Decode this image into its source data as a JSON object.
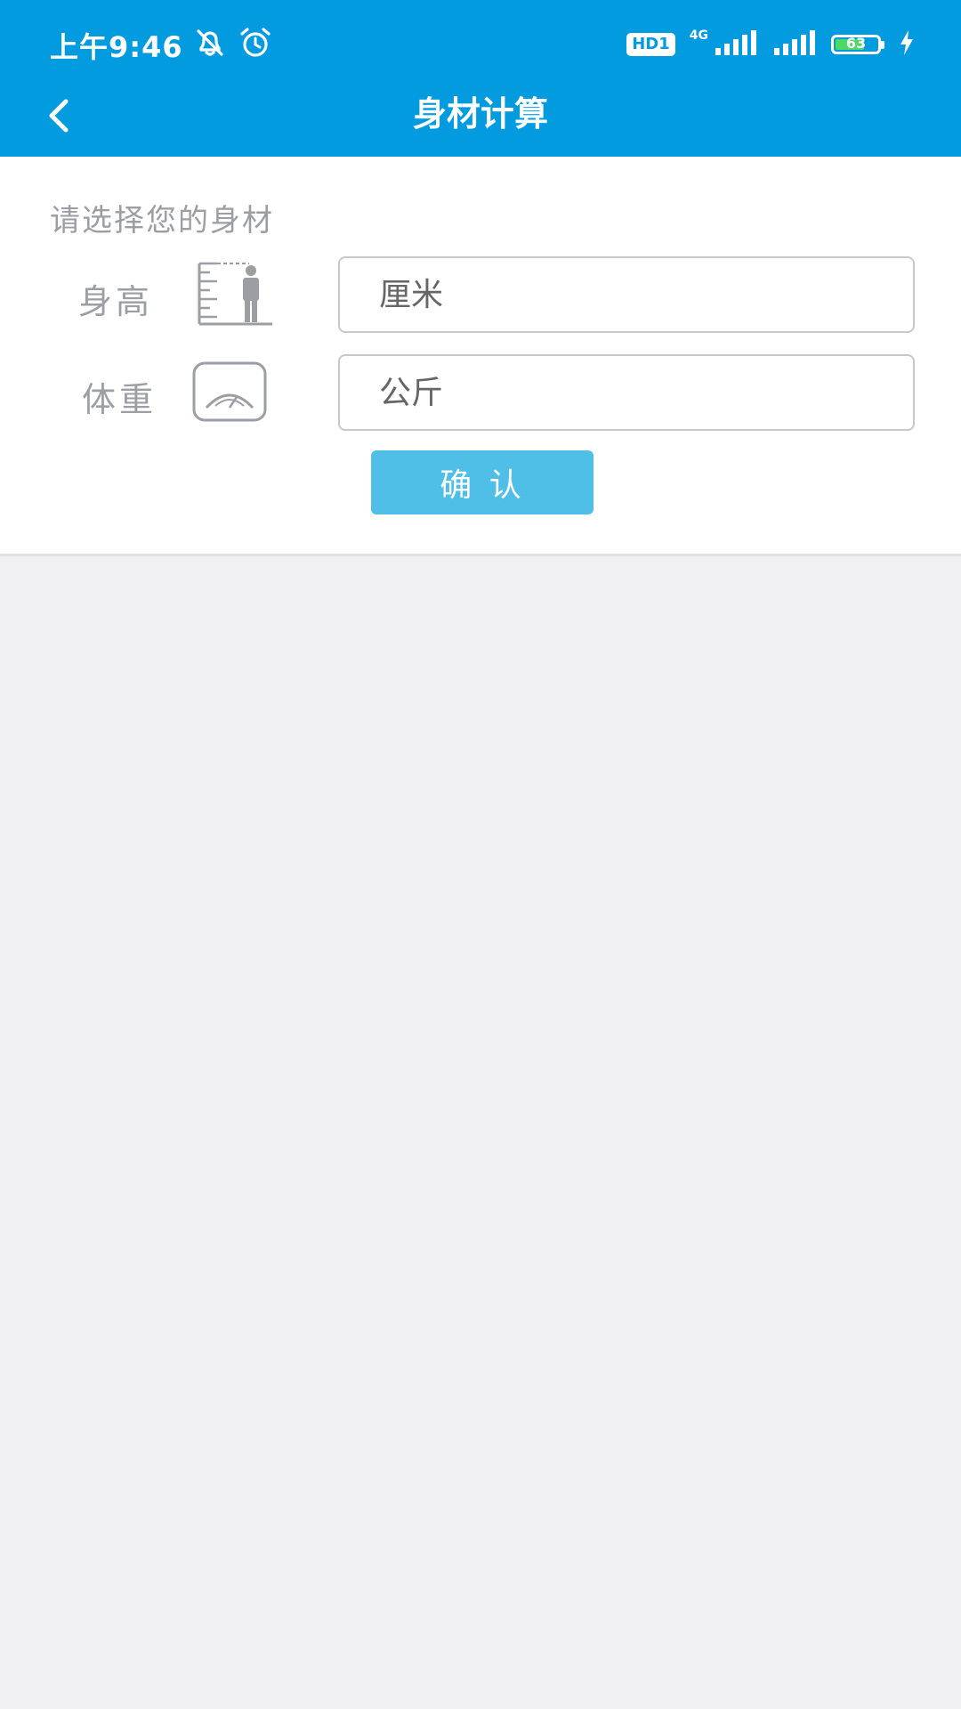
{
  "status_bar": {
    "time": "上午9:46",
    "hd_label": "HD1",
    "network": "4G",
    "battery_level": "63"
  },
  "nav": {
    "title": "身材计算"
  },
  "form": {
    "prompt": "请选择您的身材",
    "height": {
      "label": "身高",
      "placeholder": "厘米"
    },
    "weight": {
      "label": "体重",
      "placeholder": "公斤"
    },
    "confirm_label": "确 认"
  },
  "colors": {
    "header_bg": "#039be0",
    "button_bg": "#50bfe8",
    "page_bg": "#efeff4"
  }
}
